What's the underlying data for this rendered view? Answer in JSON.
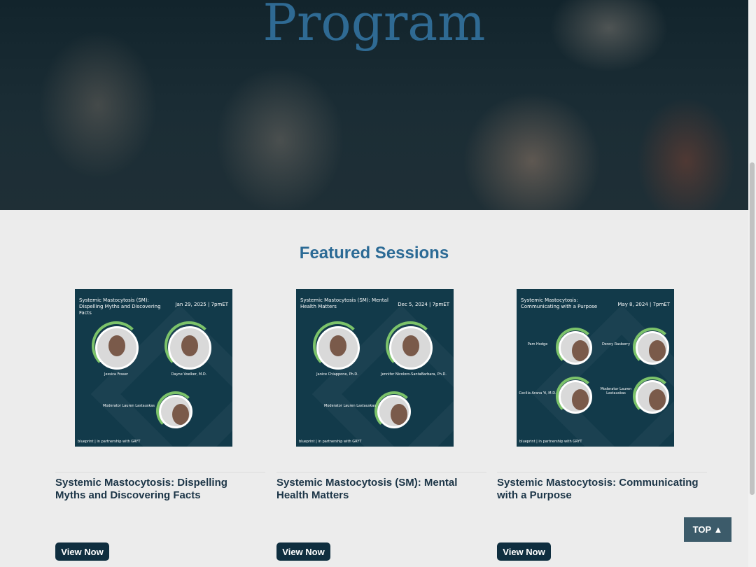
{
  "hero": {
    "title": "Program"
  },
  "featured": {
    "heading": "Featured Sessions",
    "cards": [
      {
        "thumb_title": "Systemic Mastocytosis (SM): Dispelling Myths and Discovering Facts",
        "thumb_date": "Jan 29, 2025 | 7pmET",
        "speakers": [
          "Jessica Fraser",
          "Dayne Voelker, M.D.",
          "Moderator Lauren Lastauskas"
        ],
        "footer": "blueprint | in partnership with GRYT",
        "title": "Systemic Mastocytosis: Dispelling Myths and Discovering Facts",
        "button": "View Now"
      },
      {
        "thumb_title": "Systemic Mastocytosis (SM): Mental Health Matters",
        "thumb_date": "Dec 5, 2024 | 7pmET",
        "speakers": [
          "Janice Chiappone, Ph.D.",
          "Jennifer Nicoloro-SantaBarbara, Ph.D.",
          "Moderator Lauren Lastauskas"
        ],
        "footer": "blueprint | in partnership with GRYT",
        "title": "Systemic Mastocytosis (SM): Mental Health Matters",
        "button": "View Now"
      },
      {
        "thumb_title": "Systemic Mastocytosis: Communicating with a Purpose",
        "thumb_date": "May 8, 2024 | 7pmET",
        "speakers": [
          "Pam Hodge",
          "Denny Rasberry",
          "Cecilia Arana Yi, M.D.",
          "Moderator Lauren Lastauskas"
        ],
        "footer": "blueprint | in partnership with GRYT",
        "title": "Systemic Mastocytosis: Communicating with a Purpose",
        "button": "View Now"
      }
    ]
  },
  "top_button": "TOP ▲"
}
